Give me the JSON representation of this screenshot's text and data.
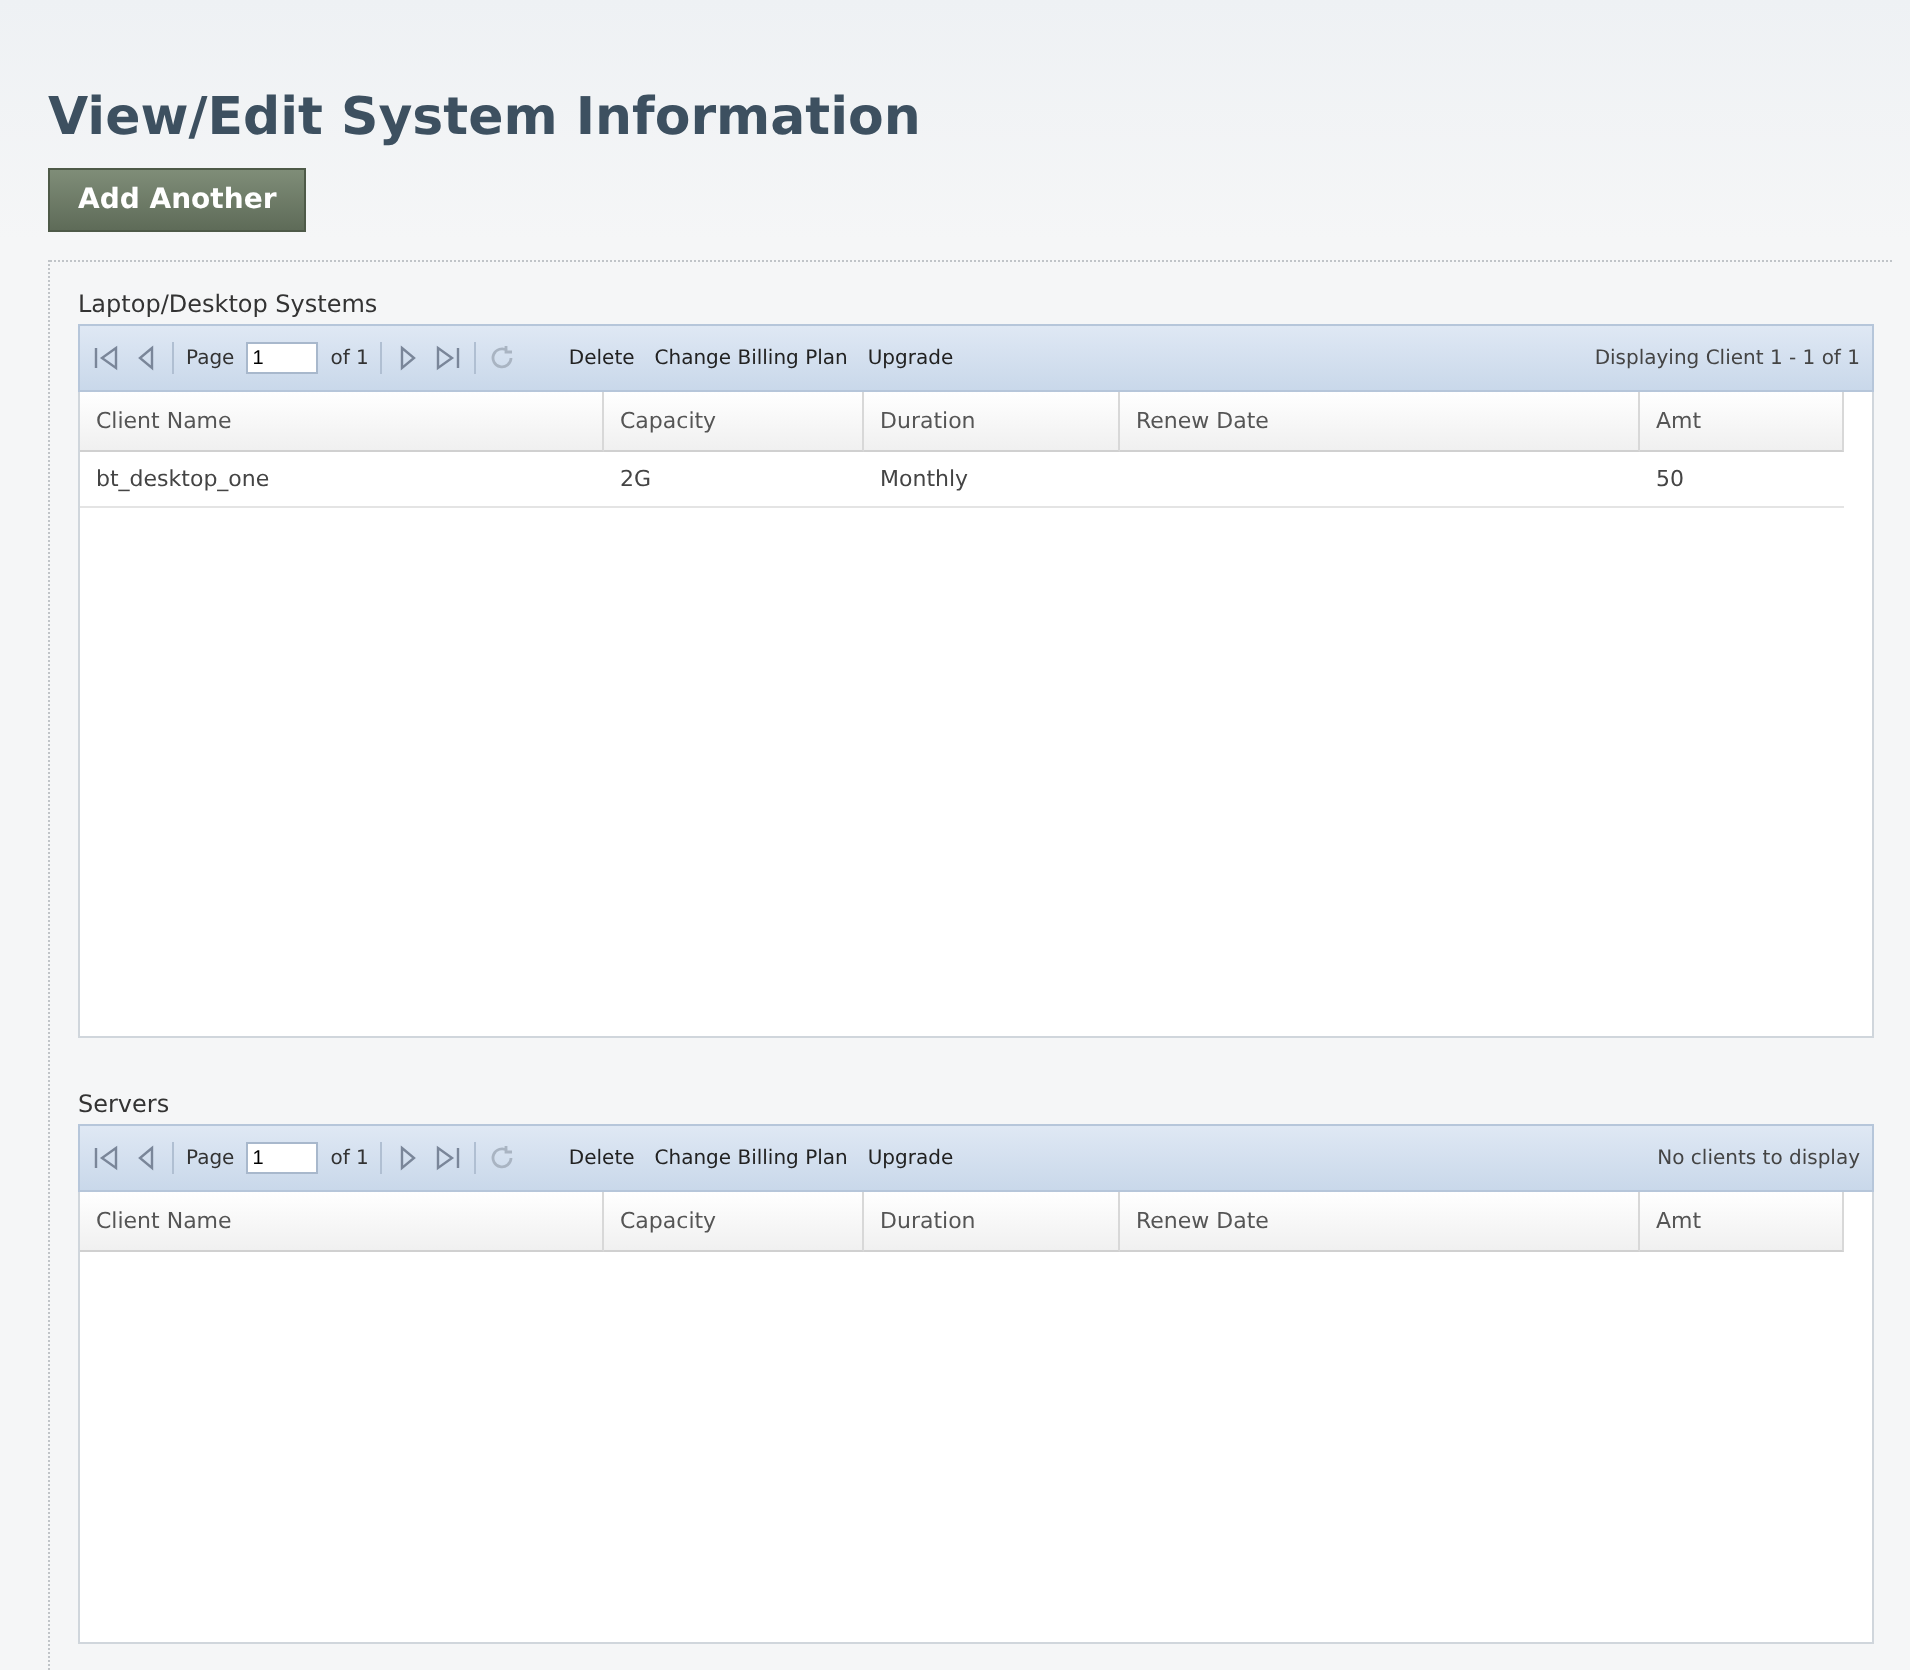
{
  "page_title": "View/Edit System Information",
  "add_button": "Add Another",
  "grids": [
    {
      "title": "Laptop/Desktop Systems",
      "page_label": "Page",
      "page_value": "1",
      "page_of": "of 1",
      "actions": [
        "Delete",
        "Change Billing Plan",
        "Upgrade"
      ],
      "display_info": "Displaying Client 1 - 1 of 1",
      "columns": [
        "Client Name",
        "Capacity",
        "Duration",
        "Renew Date",
        "Amt"
      ],
      "rows": [
        [
          "bt_desktop_one",
          "2G",
          "Monthly",
          "",
          "50"
        ]
      ]
    },
    {
      "title": "Servers",
      "page_label": "Page",
      "page_value": "1",
      "page_of": "of 1",
      "actions": [
        "Delete",
        "Change Billing Plan",
        "Upgrade"
      ],
      "display_info": "No clients to display",
      "columns": [
        "Client Name",
        "Capacity",
        "Duration",
        "Renew Date",
        "Amt"
      ]
    }
  ]
}
